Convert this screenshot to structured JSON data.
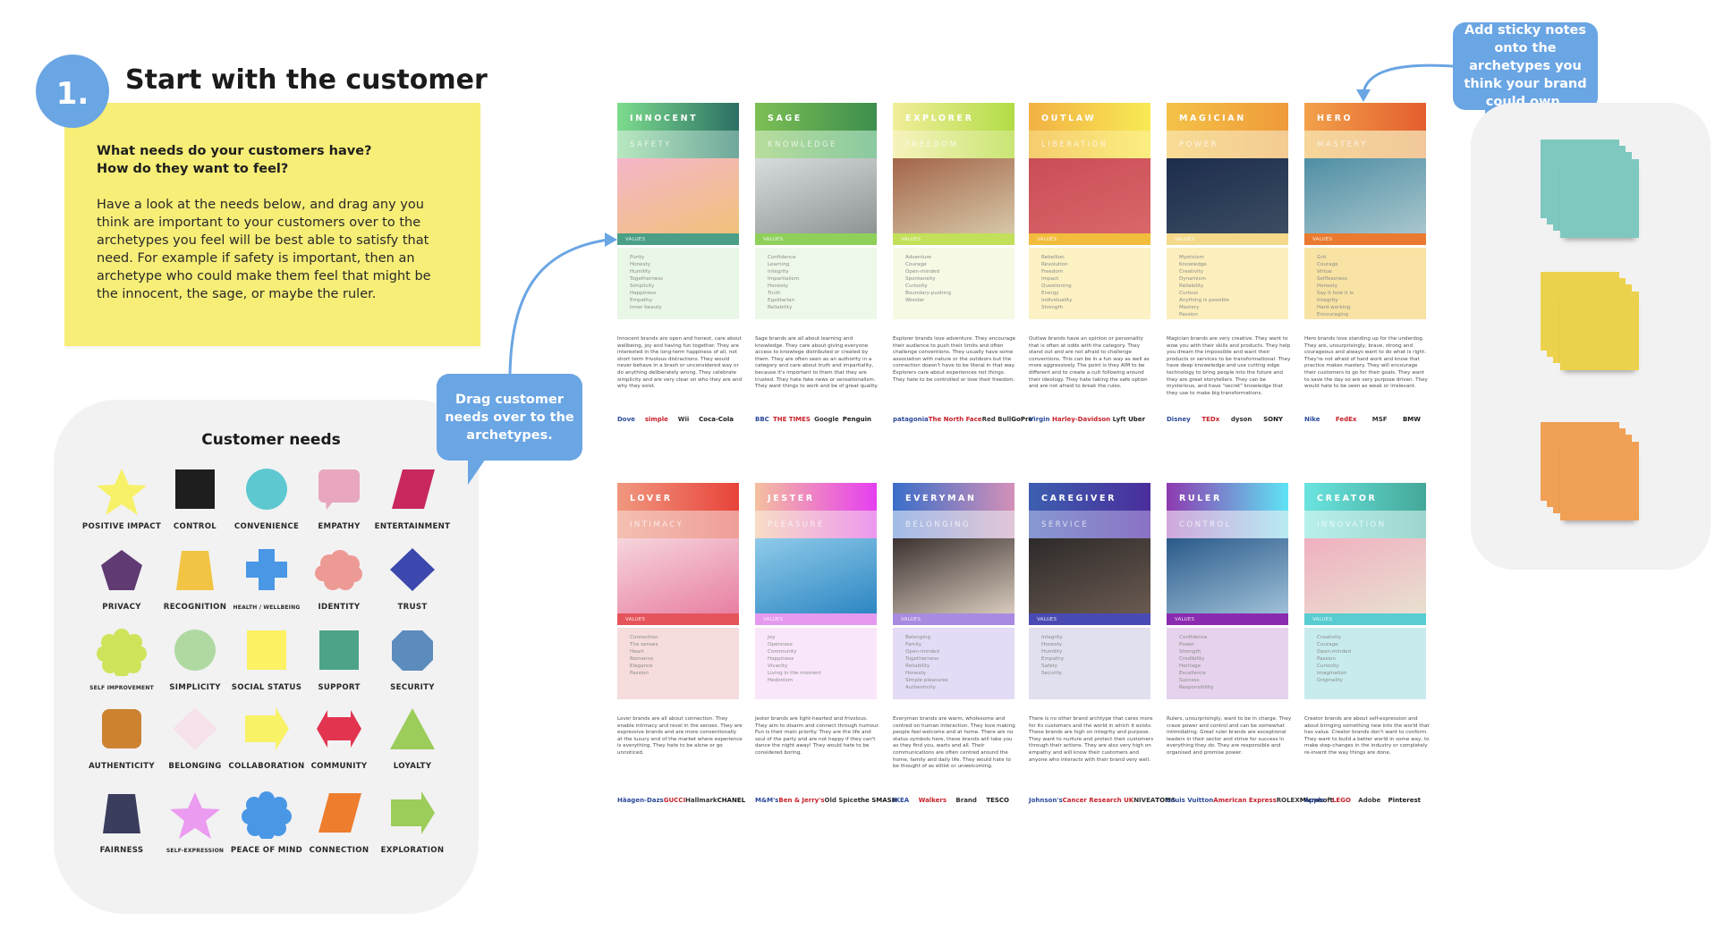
{
  "step": {
    "number": "1.",
    "title": "Start with the customer"
  },
  "intro": {
    "question_1": "What needs do your customers have?",
    "question_2": "How do they want to feel?",
    "body": "Have a look at the needs below, and drag any you think are important to your customers over to the archetypes you feel will be best able to satisfy that need. For example if safety is important, then an archetype who could make them feel that might be the innocent, the sage, or maybe the ruler."
  },
  "needs_panel": {
    "title": "Customer needs",
    "items": [
      {
        "label": "Positive impact",
        "shape": "star",
        "color": "#f7f16a"
      },
      {
        "label": "Control",
        "shape": "square",
        "color": "#1e1e1e"
      },
      {
        "label": "Convenience",
        "shape": "circle",
        "color": "#5ec8d0"
      },
      {
        "label": "Empathy",
        "shape": "speech",
        "color": "#e8a6c0"
      },
      {
        "label": "Entertainment",
        "shape": "parallelogram",
        "color": "#c8285e"
      },
      {
        "label": "Privacy",
        "shape": "pentagon",
        "color": "#603a72"
      },
      {
        "label": "Recognition",
        "shape": "trapezoid",
        "color": "#f2c443"
      },
      {
        "label": "Health / wellbeing",
        "shape": "cross",
        "color": "#4a97e6",
        "small": true
      },
      {
        "label": "Identity",
        "shape": "cloud",
        "color": "#ee9a94"
      },
      {
        "label": "Trust",
        "shape": "diamond",
        "color": "#3c48ad"
      },
      {
        "label": "Self improvement",
        "shape": "flower",
        "color": "#cfe35b",
        "small": true
      },
      {
        "label": "Simplicity",
        "shape": "circle",
        "color": "#afd9a1"
      },
      {
        "label": "Social status",
        "shape": "square",
        "color": "#fcf263"
      },
      {
        "label": "Support",
        "shape": "square",
        "color": "#4da38a"
      },
      {
        "label": "Security",
        "shape": "octagon",
        "color": "#5c8bbd"
      },
      {
        "label": "Authenticity",
        "shape": "rounded-square",
        "color": "#cc8231"
      },
      {
        "label": "Belonging",
        "shape": "diamond",
        "color": "#f6e2eb"
      },
      {
        "label": "Collaboration",
        "shape": "arrow",
        "color": "#f8f267"
      },
      {
        "label": "Community",
        "shape": "double-arrow",
        "color": "#e2344f"
      },
      {
        "label": "Loyalty",
        "shape": "triangle",
        "color": "#9ccc5a"
      },
      {
        "label": "Fairness",
        "shape": "trapezoid",
        "color": "#3a3d5c"
      },
      {
        "label": "Self-expression",
        "shape": "star",
        "color": "#eb9bf0",
        "small": true
      },
      {
        "label": "Peace of mind",
        "shape": "flower",
        "color": "#4a97e6"
      },
      {
        "label": "Connection",
        "shape": "parallelogram",
        "color": "#ee7d2e"
      },
      {
        "label": "Exploration",
        "shape": "arrow",
        "color": "#9ccc5a"
      }
    ]
  },
  "drag_bubble": "Drag customer needs over to the archetypes.",
  "sticky_bubble": "Add sticky notes onto the archetypes you think your brand could own.",
  "sticky_stacks": [
    {
      "name": "teal",
      "color": "#7fc8c0"
    },
    {
      "name": "yellow",
      "color": "#ecd24c"
    },
    {
      "name": "orange",
      "color": "#f0a156"
    }
  ],
  "archetypes": [
    {
      "name": "INNOCENT",
      "need": "SAFETY",
      "values_label": "VALUES",
      "values": [
        "Purity",
        "Honesty",
        "Humility",
        "Togetherness",
        "Simplicity",
        "Happiness",
        "Empathy",
        "Inner beauty"
      ],
      "description": "Innocent brands are open and honest, care about wellbeing, joy and having fun together. They are interested in the long-term happiness of all, not short term frivolous distractions. They would never behave in a brash or unconsidered way or do anything deliberately wrong. They celebrate simplicity and are very clear on who they are and why they exist.",
      "logos": [
        "Dove",
        "simple",
        "Wii",
        "Coca-Cola"
      ],
      "colors": {
        "head_a": "#7ddc8e",
        "head_b": "#2b6f64",
        "sub_a": "#b8e8c0",
        "sub_b": "#6fa89c",
        "strip": "#4a9f86",
        "vals": "#e9f7e6",
        "photo_a": "#f4b6c9",
        "photo_b": "#f1c17a"
      }
    },
    {
      "name": "SAGE",
      "need": "KNOWLEDGE",
      "values_label": "VALUES",
      "values": [
        "Confidence",
        "Learning",
        "Integrity",
        "Impartialism",
        "Honesty",
        "Truth",
        "Egalitarian",
        "Reliability"
      ],
      "description": "Sage brands are all about learning and knowledge. They care about giving everyone access to knowlege distributed or created by them. They are often seen as an authority in a category and care about truth and impartiality, because it's important to them that they are trusted. They hate fake news or sensationalism. They want things to work and be of great quality.",
      "logos": [
        "BBC",
        "THE TIMES",
        "Google",
        "Penguin"
      ],
      "colors": {
        "head_a": "#7dbf55",
        "head_b": "#3d8e4d",
        "sub_a": "#b7dd9c",
        "sub_b": "#8ac9a0",
        "strip": "#8fd05a",
        "vals": "#eef8e8",
        "photo_a": "#d8dcdc",
        "photo_b": "#8e9494"
      }
    },
    {
      "name": "EXPLORER",
      "need": "FREEDOM",
      "values_label": "VALUES",
      "values": [
        "Adventure",
        "Courage",
        "Open-minded",
        "Spontaneity",
        "Curiosity",
        "Boundary-pushing",
        "Wonder"
      ],
      "description": "Explorer brands love adventure. They encourage their audience to push their limits and often challenge conventions. They usually have some association with nature or the outdoors but the connection doesn't have to be literal in that way. Explorers care about experiences not things. They hate to be controlled or lose their freedom.",
      "logos": [
        "patagonia",
        "The North Face",
        "Red Bull",
        "GoPro"
      ],
      "colors": {
        "head_a": "#f2ee9a",
        "head_b": "#b2dc47",
        "sub_a": "#f7f3bc",
        "sub_b": "#c9e574",
        "strip": "#c3e05a",
        "vals": "#f6f9e4",
        "photo_a": "#a46549",
        "photo_b": "#d6c7a8"
      }
    },
    {
      "name": "OUTLAW",
      "need": "LIBERATION",
      "values_label": "VALUES",
      "values": [
        "Rebellion",
        "Revolution",
        "Freedom",
        "Impact",
        "Questioning",
        "Energy",
        "Individuality",
        "Strength"
      ],
      "description": "Outlaw brands have an opinion or personality that is often at odds with the category. They stand out and are not afraid to challenge conventions. This can be in a fun way as well as more aggressively. The point is they AIM to be different and to create a cult following around their ideology. They hate taking the safe option and are not afraid to break the rules.",
      "logos": [
        "Virgin",
        "Harley-Davidson",
        "Lyft",
        "Uber"
      ],
      "colors": {
        "head_a": "#f2b144",
        "head_b": "#f8ea55",
        "sub_a": "#f6cc6e",
        "sub_b": "#fbef80",
        "strip": "#f2bd3c",
        "vals": "#fcf2c4",
        "photo_a": "#c94d55",
        "photo_b": "#d9676a"
      }
    },
    {
      "name": "MAGICIAN",
      "need": "POWER",
      "values_label": "VALUES",
      "values": [
        "Mysticism",
        "Knowledge",
        "Creativity",
        "Dynamism",
        "Reliability",
        "Curious",
        "Anything is possible",
        "Mastery",
        "Passion"
      ],
      "description": "Magician brands are very creative. They want to wow you with their skills and products. They help you dream the impossible and want their products or services to be transformational. They have deep knoweledge and use cutting edge technology to bring people into the future and they are great storytellers. They can be mysterious, and have \"secret\" knowledge that they use to make big transformations.",
      "logos": [
        "Disney",
        "TEDx",
        "dyson",
        "SONY"
      ],
      "colors": {
        "head_a": "#f4c248",
        "head_b": "#ef9a3a",
        "sub_a": "#f8dc95",
        "sub_b": "#f4cb93",
        "strip": "#f5d98a",
        "vals": "#fcefbd",
        "photo_a": "#1c2c4c",
        "photo_b": "#3c4d62"
      }
    },
    {
      "name": "HERO",
      "need": "MASTERY",
      "values_label": "VALUES",
      "values": [
        "Grit",
        "Courage",
        "Virtue",
        "Selflessness",
        "Honesty",
        "Say it how it is",
        "Integrity",
        "Hard working",
        "Encouraging"
      ],
      "description": "Hero brands love standing up for the underdog. They are, unsurprisingly, brave, strong and courageous and always want to do what is right. They're not afraid of hard work and know that practice makes mastery. They will encourage their customers to go for their goals. They want to save the day so are very purpose driven. They would hate to be seen as weak or irrelevant.",
      "logos": [
        "Nike",
        "FedEx",
        "MSF",
        "BMW"
      ],
      "colors": {
        "head_a": "#f2a14a",
        "head_b": "#e45e2e",
        "sub_a": "#f6d59a",
        "sub_b": "#f2c89a",
        "strip": "#ea7a30",
        "vals": "#f8e3a4",
        "photo_a": "#4f8ea4",
        "photo_b": "#a8c6cd"
      }
    },
    {
      "name": "LOVER",
      "need": "INTIMACY",
      "values_label": "VALUES",
      "values": [
        "Connection",
        "The senses",
        "Heart",
        "Romance",
        "Elegance",
        "Passion"
      ],
      "description": "Lover brands are all about connection. They enable intimacy and revel in the senses. They are expressive brands and are more conventionally at the luxury end of the market where experience is everything. They hate to be alone or go unnoticed.",
      "logos": [
        "Häagen-Dazs",
        "GUCCI",
        "Hallmark",
        "CHANEL"
      ],
      "colors": {
        "head_a": "#f09880",
        "head_b": "#e8433a",
        "sub_a": "#f4bfb0",
        "sub_b": "#ef9e98",
        "strip": "#e5545a",
        "vals": "#f6dcdc",
        "photo_a": "#f6d5dc",
        "photo_b": "#e87fa2"
      }
    },
    {
      "name": "JESTER",
      "need": "PLEASURE",
      "values_label": "VALUES",
      "values": [
        "Joy",
        "Openness",
        "Community",
        "Happiness",
        "Vivacity",
        "Living in the moment",
        "Hedonism"
      ],
      "description": "Jester brands are light-hearted and frivolous. They aim to disarm and connect through humour. Fun is their main priority. They are the life and soul of the party and are not happy if they can't dance the night away! They would hate to be considered boring.",
      "logos": [
        "M&M's",
        "Ben & Jerry's",
        "Old Spice",
        "the SMASH"
      ],
      "colors": {
        "head_a": "#f4c09e",
        "head_b": "#e63ef0",
        "sub_a": "#f8dcc6",
        "sub_b": "#ec98ee",
        "strip": "#e59af0",
        "vals": "#fae6fa",
        "photo_a": "#8fcbea",
        "photo_b": "#2d86c2"
      }
    },
    {
      "name": "EVERYMAN",
      "need": "BELONGING",
      "values_label": "VALUES",
      "values": [
        "Belonging",
        "Family",
        "Open-minded",
        "Togetherness",
        "Reliability",
        "Honesty",
        "Simple pleasures",
        "Authenticity"
      ],
      "description": "Everyman brands are warm, wholesome and centred on human interaction. They love making people feel welcome and at home. There are no status symbols here, these brands will take you as they find you, warts and all. Their communications are often centred around the home, family and daily life. They would hate to be thought of as elitist or unwelcoming.",
      "logos": [
        "IKEA",
        "Walkers",
        "Brand",
        "TESCO"
      ],
      "colors": {
        "head_a": "#3a6ec9",
        "head_b": "#d490b8",
        "sub_a": "#a2bce6",
        "sub_b": "#e2c6d8",
        "strip": "#a88ae0",
        "vals": "#e4dcf6",
        "photo_a": "#3b3230",
        "photo_b": "#d8cabc"
      }
    },
    {
      "name": "CAREGIVER",
      "need": "SERVICE",
      "values_label": "VALUES",
      "values": [
        "Integrity",
        "Honesty",
        "Humility",
        "Empathy",
        "Safety",
        "Security"
      ],
      "description": "There is no other brand archtype that cares more for its customers and the world in which it exists. These brands are high on integrity and purpose. They want to nurture and protect their customers through their actions. They are also very high on empathy and will know their customers and anyone who interacts with their brand very well.",
      "logos": [
        "Johnson's",
        "Cancer Research UK",
        "NIVEA",
        "TOMS"
      ],
      "colors": {
        "head_a": "#3d5fb0",
        "head_b": "#4a2e9c",
        "sub_a": "#8798d2",
        "sub_b": "#8a72c4",
        "strip": "#4a4ab4",
        "vals": "#e0e0ef",
        "photo_a": "#2d2a2a",
        "photo_b": "#6a5a50"
      }
    },
    {
      "name": "RULER",
      "need": "CONTROL",
      "values_label": "VALUES",
      "values": [
        "Confidence",
        "Power",
        "Strength",
        "Credibility",
        "Heritage",
        "Excellence",
        "Success",
        "Responsibility"
      ],
      "description": "Rulers, unsurprisingly, want to be in charge. They crave power and control and can be somewhat intimidating. Great ruler brands are exceptional leaders in their sector and strive for success in everything they do. They are responsible and organised and promise power.",
      "logos": [
        "Louis Vuitton",
        "American Express",
        "ROLEX",
        "Microsoft"
      ],
      "colors": {
        "head_a": "#8e3ab0",
        "head_b": "#5ee4f4",
        "sub_a": "#d0a8dc",
        "sub_b": "#b8eaf2",
        "strip": "#8a2ab0",
        "vals": "#e6d2ec",
        "photo_a": "#2a5a8a",
        "photo_b": "#9fc0d8"
      }
    },
    {
      "name": "CREATOR",
      "need": "INNOVATION",
      "values_label": "VALUES",
      "values": [
        "Creativity",
        "Courage",
        "Open-minded",
        "Passion",
        "Curiosity",
        "Imagination",
        "Originality"
      ],
      "description": "Creator brands are about self-expression and about bringing something new into the world that has value. Creator brands don't want to conform. They want to build a better world in some way, to make step-changes in the industry or completely re-invent the way things are done.",
      "logos": [
        "Apple",
        "LEGO",
        "Adobe",
        "Pinterest"
      ],
      "colors": {
        "head_a": "#6ae4e0",
        "head_b": "#44a898",
        "sub_a": "#b8f0ec",
        "sub_b": "#9cd6cc",
        "strip": "#58ccd0",
        "vals": "#c8ecee",
        "photo_a": "#f0b0c0",
        "photo_b": "#e8e0d0"
      }
    }
  ]
}
